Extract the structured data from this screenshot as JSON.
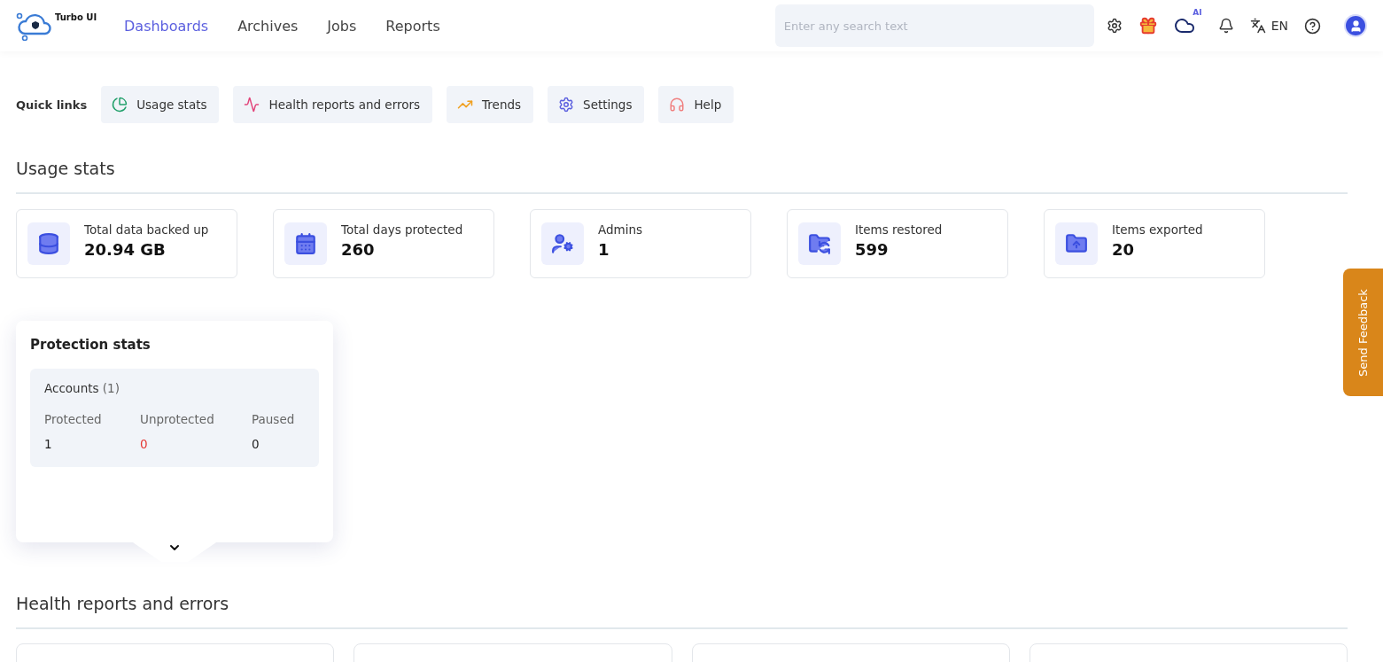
{
  "header": {
    "logo_text": "Turbo UI",
    "nav": [
      {
        "label": "Dashboards",
        "selected": true
      },
      {
        "label": "Archives",
        "selected": false
      },
      {
        "label": "Jobs",
        "selected": false
      },
      {
        "label": "Reports",
        "selected": false
      }
    ],
    "search": {
      "placeholder": "Enter any search text"
    },
    "ai_badge": "AI",
    "language": "EN"
  },
  "quick_links": {
    "label": "Quick links",
    "items": [
      {
        "label": "Usage stats",
        "kind": "pie",
        "color": "#22a06b"
      },
      {
        "label": "Health reports and errors",
        "kind": "pulse",
        "color": "#e2447a"
      },
      {
        "label": "Trends",
        "kind": "trend",
        "color": "#f0a020"
      },
      {
        "label": "Settings",
        "kind": "gear",
        "color": "#5b5fdf"
      },
      {
        "label": "Help",
        "kind": "headset",
        "color": "#f08080"
      }
    ]
  },
  "usage_stats": {
    "title": "Usage stats",
    "cards": [
      {
        "label": "Total data backed up",
        "value": "20.94 GB",
        "kind": "database"
      },
      {
        "label": "Total days protected",
        "value": "260",
        "kind": "calendar"
      },
      {
        "label": "Admins",
        "value": "1",
        "kind": "admin"
      },
      {
        "label": "Items restored",
        "value": "599",
        "kind": "restore"
      },
      {
        "label": "Items exported",
        "value": "20",
        "kind": "export"
      }
    ]
  },
  "protection_stats": {
    "title": "Protection stats",
    "group_label": "Accounts",
    "group_count": "(1)",
    "columns": [
      {
        "label": "Protected",
        "value": "1",
        "color": "#222222"
      },
      {
        "label": "Unprotected",
        "value": "0",
        "color": "#e53935"
      },
      {
        "label": "Paused",
        "value": "0",
        "color": "#222222"
      }
    ]
  },
  "health": {
    "title": "Health reports and errors"
  },
  "feedback": {
    "label": "Send Feedback"
  }
}
